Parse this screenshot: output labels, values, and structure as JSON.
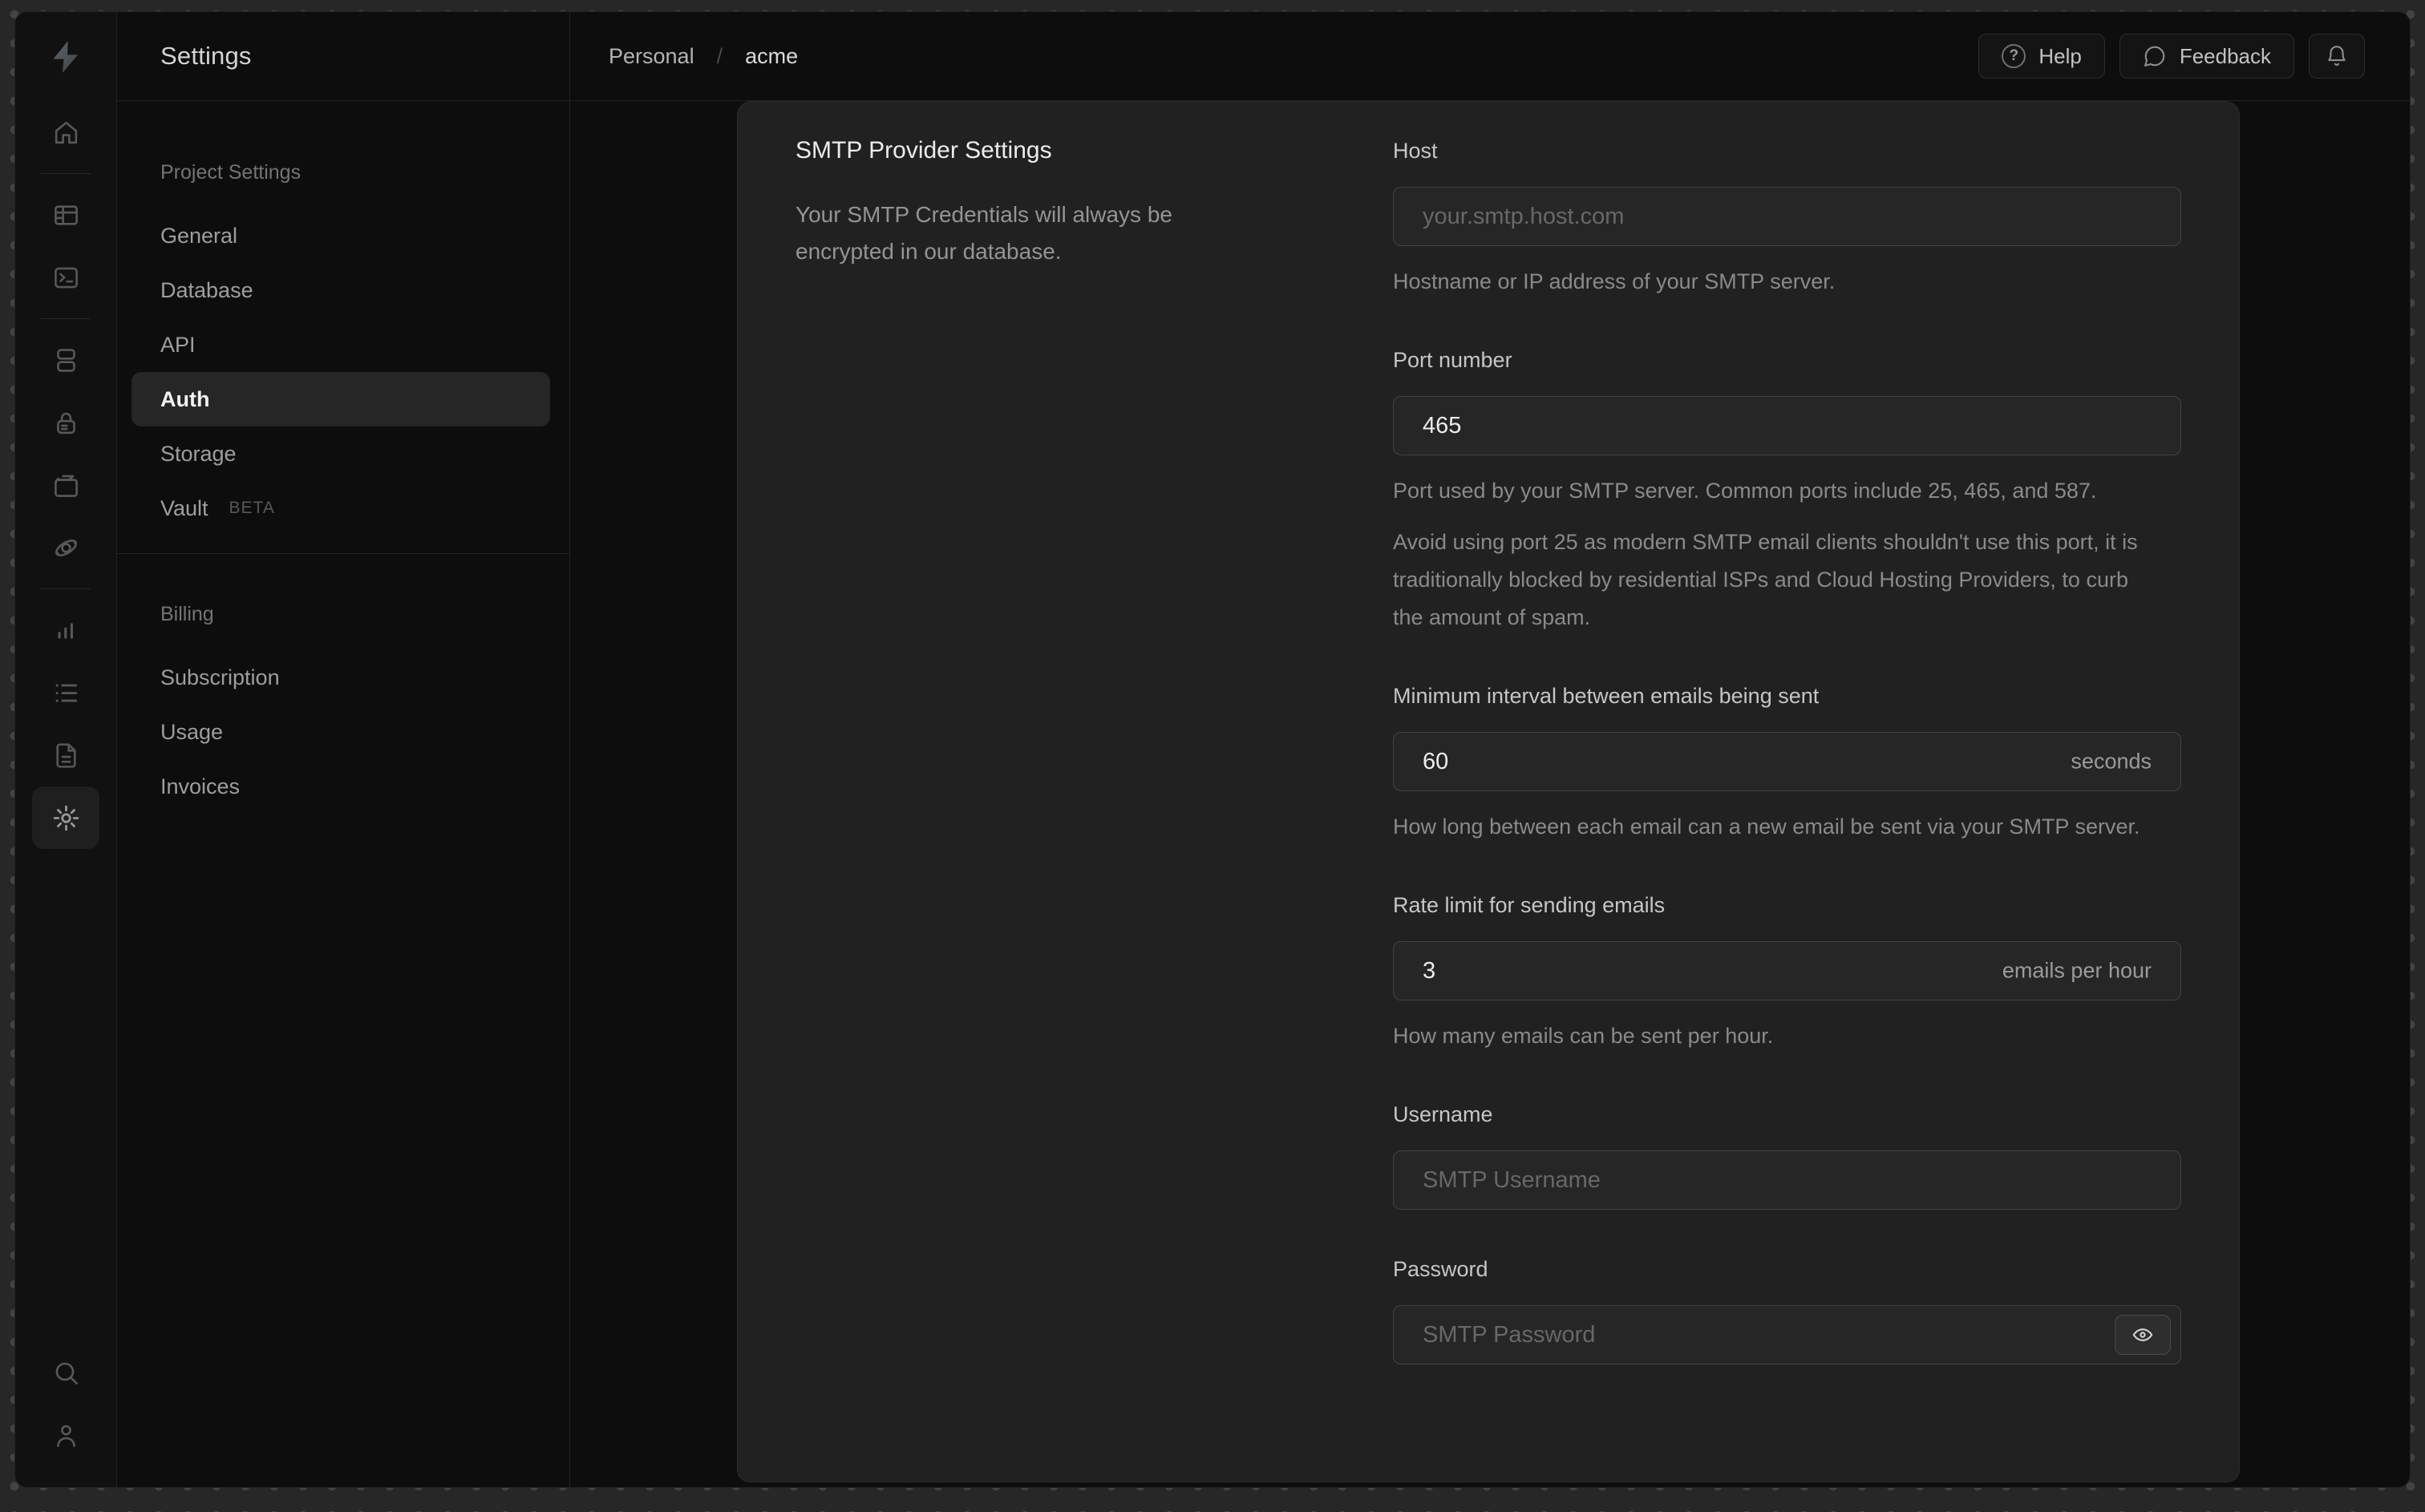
{
  "topbar": {
    "breadcrumb": {
      "org": "Personal",
      "separator": "/",
      "project": "acme"
    },
    "help_label": "Help",
    "feedback_label": "Feedback"
  },
  "rail": {
    "icons": [
      "home-icon",
      "table-editor-icon",
      "sql-editor-icon",
      "database-icon",
      "auth-lock-icon",
      "storage-icon",
      "edge-functions-icon",
      "reports-icon",
      "logs-icon",
      "api-docs-icon",
      "settings-gear-icon"
    ],
    "bottom_icons": [
      "search-icon",
      "user-icon"
    ],
    "active_icon": "settings-gear-icon"
  },
  "nav": {
    "title": "Settings",
    "sections": [
      {
        "header": "Project Settings",
        "items": [
          {
            "label": "General"
          },
          {
            "label": "Database"
          },
          {
            "label": "API"
          },
          {
            "label": "Auth",
            "active": true
          },
          {
            "label": "Storage"
          },
          {
            "label": "Vault",
            "badge": "BETA"
          }
        ]
      },
      {
        "header": "Billing",
        "items": [
          {
            "label": "Subscription"
          },
          {
            "label": "Usage"
          },
          {
            "label": "Invoices"
          }
        ]
      }
    ]
  },
  "panel": {
    "heading": "SMTP Provider Settings",
    "description": "Your SMTP Credentials will always be encrypted in our database.",
    "fields": [
      {
        "label": "Host",
        "placeholder": "your.smtp.host.com",
        "help1": "Hostname or IP address of your SMTP server."
      },
      {
        "label": "Port number",
        "value": "465",
        "help1": "Port used by your SMTP server. Common ports include 25, 465, and 587.",
        "help2": "Avoid using port 25 as modern SMTP email clients shouldn't use this port, it is traditionally blocked by residential ISPs and Cloud Hosting Providers, to curb the amount of spam."
      },
      {
        "label": "Minimum interval between emails being sent",
        "value": "60",
        "suffix": "seconds",
        "help1": "How long between each email can a new email be sent via your SMTP server."
      },
      {
        "label": "Rate limit for sending emails",
        "value": "3",
        "suffix": "emails per hour",
        "help1": "How many emails can be sent per hour."
      },
      {
        "label": "Username",
        "placeholder": "SMTP Username"
      },
      {
        "label": "Password",
        "placeholder": "SMTP Password"
      }
    ]
  },
  "colors": {
    "window_bg": "#0c0c0c",
    "panel_bg": "#212121",
    "input_bg": "#262626",
    "input_border": "#434343",
    "desktop_bg": "#272727"
  }
}
